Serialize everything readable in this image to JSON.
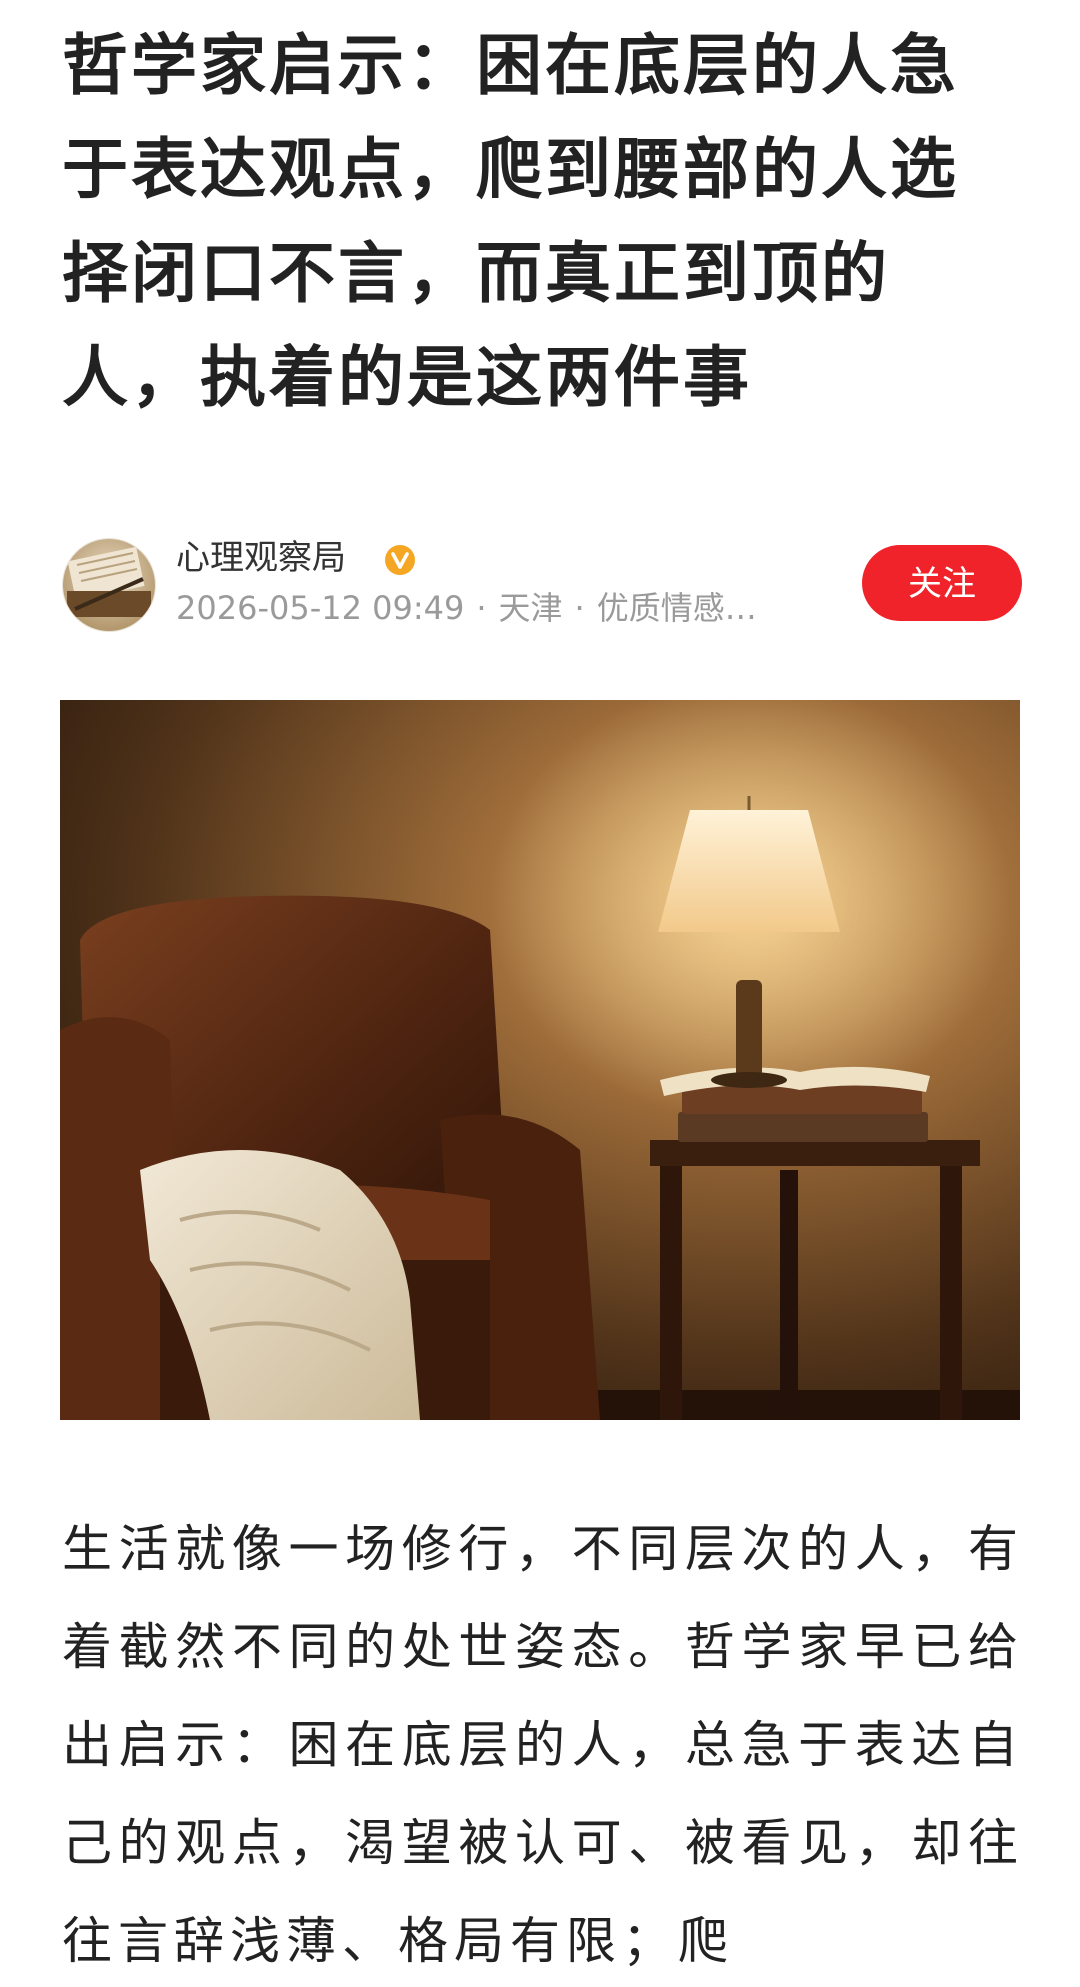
{
  "article": {
    "title": "哲学家启示：困在底层的人急于表达观点，爬到腰部的人选择闭口不言，而真正到顶的人，执着的是这两件事",
    "body_first_paragraph": "生活就像一场修行，不同层次的人，有着截然不同的处世姿态。哲学家早已给出启示：困在底层的人，总急于表达自己的观点，渴望被认可、被看见，却往往言辞浅薄、格局有限；爬"
  },
  "author": {
    "name": "心理观察局",
    "verified_icon": "verified-v-badge-icon",
    "date": "2026-05-12 09:49",
    "location": "天津",
    "category": "优质情感…",
    "separator": "·"
  },
  "follow_button": {
    "label": "关注"
  },
  "colors": {
    "follow_bg": "#f0232a",
    "verified_badge": "#f5a623",
    "meta_text": "#9a9a9a",
    "title_text": "#222222"
  },
  "cover_image": {
    "icon": "armchair-lamp-books-photo"
  }
}
